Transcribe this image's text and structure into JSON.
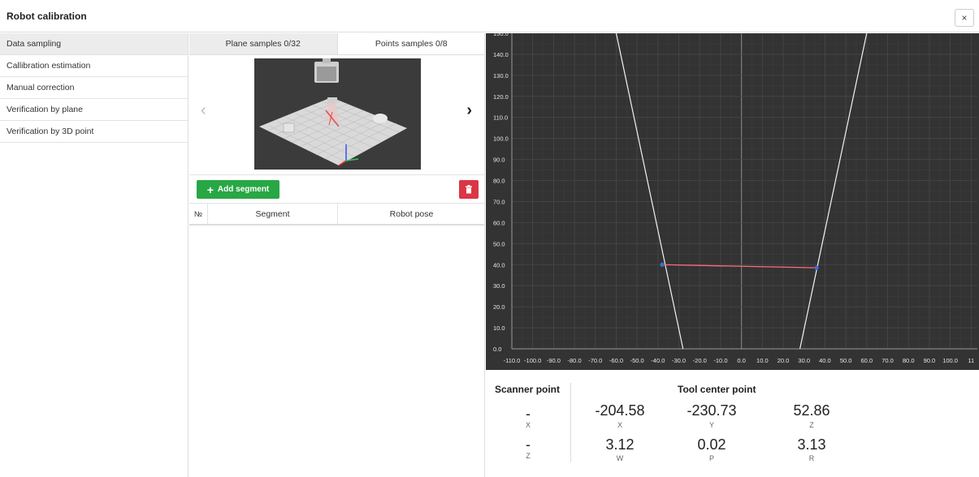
{
  "window": {
    "title": "Robot calibration",
    "close_glyph": "×"
  },
  "sidebar": {
    "items": [
      {
        "label": "Data sampling",
        "active": true
      },
      {
        "label": "Callibration estimation"
      },
      {
        "label": "Manual correction"
      },
      {
        "label": "Verification by plane"
      },
      {
        "label": "Verification by 3D point"
      }
    ]
  },
  "tabs": [
    {
      "label": "Plane samples 0/32",
      "active": true
    },
    {
      "label": "Points samples 0/8"
    }
  ],
  "carousel": {
    "prev_glyph": "‹",
    "next_glyph": "›"
  },
  "toolbar": {
    "add_label": "Add segment",
    "add_icon": "plus-icon",
    "delete_icon": "trash-icon",
    "add_color": "#28a745",
    "delete_color": "#dc3545"
  },
  "table": {
    "headers": [
      "№",
      "Segment",
      "Robot pose"
    ],
    "rows": []
  },
  "plot": {
    "background": "#333333",
    "x_ticks": [
      "-110.0",
      "-100.0",
      "-90.0",
      "-80.0",
      "-70.0",
      "-60.0",
      "-50.0",
      "-40.0",
      "-30.0",
      "-20.0",
      "-10.0",
      "0.0",
      "10.0",
      "20.0",
      "30.0",
      "40.0",
      "50.0",
      "60.0",
      "70.0",
      "80.0",
      "90.0",
      "100.0",
      "11"
    ],
    "y_ticks": [
      "0.0",
      "10.0",
      "20.0",
      "30.0",
      "40.0",
      "50.0",
      "60.0",
      "70.0",
      "80.0",
      "90.0",
      "100.0",
      "110.0",
      "120.0",
      "130.0",
      "140.0",
      "150.0"
    ],
    "xlim": [
      -110,
      113
    ],
    "ylim": [
      0,
      150
    ],
    "fov_lines": [
      {
        "x1": -60,
        "y1": 150,
        "x2": -28,
        "y2": 0
      },
      {
        "x1": 60,
        "y1": 150,
        "x2": 28,
        "y2": 0
      }
    ],
    "segment": {
      "x1": -38,
      "y1": 40,
      "x2": 36,
      "y2": 38.5,
      "color": "#ff6b7a",
      "point_color": "#3a6fd8"
    }
  },
  "readout": {
    "scanner": {
      "title": "Scanner point",
      "values": [
        {
          "value": "-",
          "label": "X"
        },
        {
          "value": "-",
          "label": "Z"
        }
      ]
    },
    "tcp": {
      "title": "Tool center point",
      "values": [
        {
          "value": "-204.58",
          "label": "X"
        },
        {
          "value": "-230.73",
          "label": "Y"
        },
        {
          "value": "52.86",
          "label": "Z"
        },
        {
          "value": "3.12",
          "label": "W"
        },
        {
          "value": "0.02",
          "label": "P"
        },
        {
          "value": "3.13",
          "label": "R"
        }
      ]
    }
  }
}
